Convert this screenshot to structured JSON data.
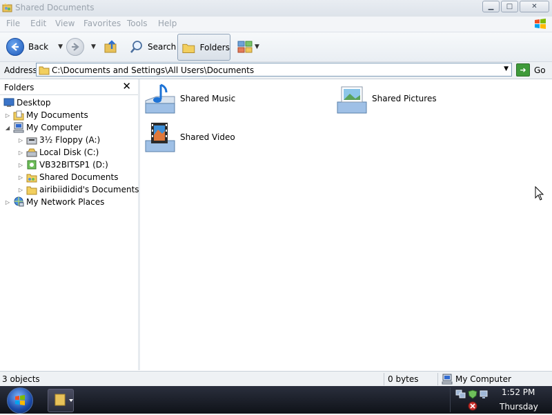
{
  "window": {
    "title": "Shared Documents",
    "controls": {
      "minimize": "▁",
      "maximize": "□",
      "close": "✕"
    }
  },
  "menubar": {
    "items": [
      "File",
      "Edit",
      "View",
      "Favorites",
      "Tools",
      "Help"
    ]
  },
  "toolbar": {
    "back_label": "Back",
    "search_label": "Search",
    "folders_label": "Folders"
  },
  "address": {
    "label": "Address",
    "value": "C:\\Documents and Settings\\All Users\\Documents",
    "go_label": "Go"
  },
  "folders_pane": {
    "title": "Folders",
    "close_glyph": "✕",
    "items": [
      {
        "label": "Desktop",
        "icon": "desktop-icon"
      },
      {
        "label": "My Documents",
        "icon": "my-documents-icon"
      },
      {
        "label": "My Computer",
        "icon": "my-computer-icon"
      },
      {
        "label": "3½ Floppy (A:)",
        "icon": "floppy-icon"
      },
      {
        "label": "Local Disk (C:)",
        "icon": "local-disk-icon"
      },
      {
        "label": "VB32BITSP1 (D:)",
        "icon": "cd-drive-icon"
      },
      {
        "label": "Shared Documents",
        "icon": "shared-folder-icon"
      },
      {
        "label": "airibiididid's Documents",
        "icon": "folder-icon"
      },
      {
        "label": "My Network Places",
        "icon": "network-icon"
      }
    ]
  },
  "content": {
    "items": [
      {
        "label": "Shared Music",
        "icon": "music-folder-icon"
      },
      {
        "label": "Shared Pictures",
        "icon": "pictures-folder-icon"
      },
      {
        "label": "Shared Video",
        "icon": "video-folder-icon"
      }
    ]
  },
  "statusbar": {
    "objects": "3 objects",
    "size": "0 bytes",
    "zone": "My Computer"
  },
  "taskbar": {
    "time": "1:52 PM",
    "day": "Thursday"
  },
  "colors": {
    "toolbar_blue": "#1b57b8",
    "taskbar": "#1a1e28",
    "go_green": "#3f9a3a"
  }
}
